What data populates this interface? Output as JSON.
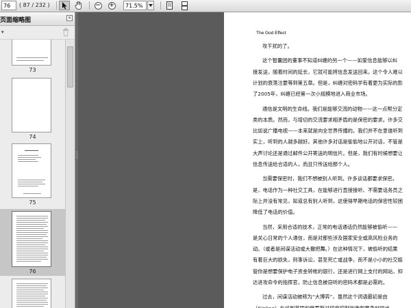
{
  "toolbar": {
    "page_current": "76",
    "page_total_display": "( 87 / 232 )",
    "zoom_value": "71.5%",
    "icons": [
      "select-arrow-icon",
      "hand-tool-icon",
      "zoom-out-icon",
      "zoom-in-icon",
      "zoom-dropdown-icon",
      "single-page-icon",
      "continuous-page-icon"
    ]
  },
  "sidebar": {
    "title": "页面缩略图",
    "close_glyph": "×",
    "options_glyph": "▾",
    "thumbnails": [
      {
        "label": "73",
        "selected": false
      },
      {
        "label": "74",
        "selected": false
      },
      {
        "label": "75",
        "selected": false
      },
      {
        "label": "76",
        "selected": true
      },
      {
        "label": "77",
        "selected": false
      }
    ]
  },
  "document": {
    "running_header": "The God Effect",
    "lines": [
      "攻干扰的了。",
      "",
      "这个智囊团的董事不知道纠缠的另一个——如爱信息能够以纠",
      "接发送，随着时间的延长，它就可能将信息发送回来。这个令人难以",
      "计划的衰落注要等到第五章。但是，纠缠对密码学有着更为实际的影",
      "了2005年，纠缠已经第一次小规模地进入商业市场。",
      "",
      "通信是文明的生命线。我们是能够交流的动物——这一点帮分定",
      "类的本质。然而，与增切的交流要求相矛盾的是保密的要求。许多交",
      "比如说广播电视——本来就是向全世界传播的。我们并不在意谁听到",
      "实上，听到的人越多越好。其他许多对话是偷偷地公开对话，不管是",
      "大声讨论还是通过邮件公开寄送的明信片。但是，我们有时候想要让",
      "信息传送给合适的人，而且只传送给那个人。",
      "",
      "当需要保密时，我们不想被别人听到。许多谈话都要求保密。",
      "是，电话作为一种社交工具，在能够进行直接接听、不需要话务员之",
      "际上并没有常见，知道总有别人听到，这使得早期电话的保密性较困",
      "降低了电话的价值。",
      "",
      "当然，采用合适的技术，正常的电话通话仍然能够被偷听——",
      "是关心日常的个人通信，而是对那些涉及国家安全或高风险业务的",
      "动。（或者是间谍活动或大撒把舞。）在这种情况下，被偷听的结果",
      "有着巨大的损失，刑事诉讼，甚至死亡或战争，而不是小小的社交尴",
      "管你是想要保护电子资金转帐的银行，还是进行网上支付的网站，抑",
      "达进攻命令的指挥官，防止信息被窃听的密码术都是必需的。",
      "",
      "过去，间谍活动被称为“大博弈”，虽然这个词语最初是由",
      "（Kipling）在谈到英国和俄罗斯对印度控制的激烈竞争时提出",
      "是，“大博弈”似乎还更适合用于编制密码的科学——密码学和"
    ]
  }
}
